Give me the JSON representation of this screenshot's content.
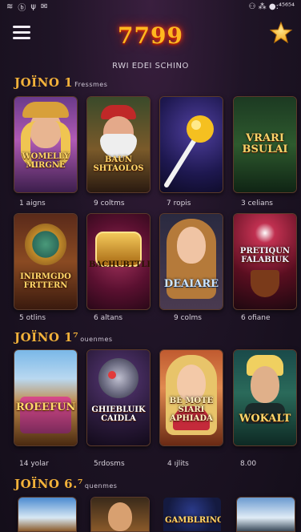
{
  "status_bar": {
    "left_glyphs": [
      "≋",
      "ⓑ",
      "ψ",
      "✉"
    ],
    "right_text": "⚇ ⁂ ●:⁴⁵⁶⁵⁴"
  },
  "header": {
    "logo_text": "7799",
    "subtitle": "RWI EDEI SCHINO"
  },
  "sections": [
    {
      "title": "JOÏNO 1",
      "subtitle": "Fressmes",
      "games": [
        {
          "title": "WOMELLY MIRGNE",
          "caption": "1 aigns"
        },
        {
          "title": "BAUN SHTAOLOS",
          "caption": "9 coltms"
        },
        {
          "title": "",
          "caption": "7 ropis"
        },
        {
          "title": "VRARI BSULAI",
          "caption": "3 celians"
        }
      ]
    },
    {
      "title": "",
      "subtitle": "",
      "games": [
        {
          "title": "INIRMGDO FRTTERN",
          "caption": "5 otlins"
        },
        {
          "title": "BACHUBTTLE",
          "caption": "6 altans"
        },
        {
          "title": "DEAIARE",
          "caption": "9 colms"
        },
        {
          "title": "PRETIQUN FALABIUK",
          "caption": "6 ofiane"
        }
      ]
    },
    {
      "title": "JOÏNO 1⁷",
      "subtitle": "ouenmes",
      "games": [
        {
          "title": "ROEEFUN",
          "caption": "14 yolar"
        },
        {
          "title": "GHIEBLUIK CAIDLA",
          "caption": "5rdosms"
        },
        {
          "title": "BE MOTE SIARI APHIADA",
          "caption": "4 ıjlits"
        },
        {
          "title": "WOKALT",
          "caption": "8.00"
        }
      ]
    },
    {
      "title": "JOÏNO 6.⁷",
      "subtitle": "quenmes",
      "games": [
        {
          "title": "",
          "caption": ""
        },
        {
          "title": "",
          "caption": ""
        },
        {
          "title": "GAMBLRINOC",
          "caption": ""
        },
        {
          "title": "",
          "caption": ""
        }
      ]
    }
  ],
  "colors": {
    "accent_gold": "#f3b23a",
    "logo_glow": "#ff3b12",
    "background": "#1f1426"
  },
  "icons": [
    "hamburger-menu-icon",
    "star-icon"
  ]
}
